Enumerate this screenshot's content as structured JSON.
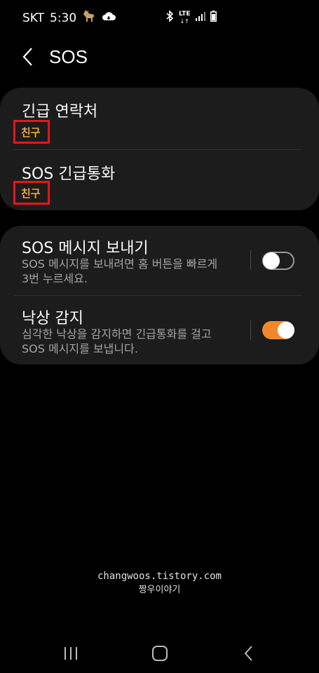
{
  "status_bar": {
    "carrier": "SKT",
    "time": "5:30",
    "network": "LTE"
  },
  "header": {
    "title": "SOS"
  },
  "contacts_card": {
    "items": [
      {
        "title": "긴급 연락처",
        "value": "친구"
      },
      {
        "title": "SOS 긴급통화",
        "value": "친구"
      }
    ]
  },
  "settings_card": {
    "items": [
      {
        "title": "SOS 메시지 보내기",
        "desc_line1": "SOS 메시지를 보내려면 홈 버튼을 빠르게",
        "desc_line2": "3번 누르세요.",
        "enabled": false
      },
      {
        "title": "낙상 감지",
        "desc_line1": "심각한 낙상을 감지하면 긴급통화를 걸고",
        "desc_line2": "SOS 메시지를 보냅니다.",
        "enabled": true
      }
    ]
  },
  "watermark": {
    "line1": "changwoos.tistory.com",
    "line2": "짱우이야기"
  },
  "colors": {
    "accent": "#f0892d",
    "highlight_border": "#e8141c",
    "value_text": "#f2a53a",
    "card_bg": "#1c1c1c"
  },
  "icons": [
    "deer-icon",
    "cloud-sync-icon",
    "bluetooth-icon",
    "lte-icon",
    "signal-icon",
    "battery-icon",
    "back-icon",
    "recents-icon",
    "home-icon",
    "nav-back-icon"
  ]
}
